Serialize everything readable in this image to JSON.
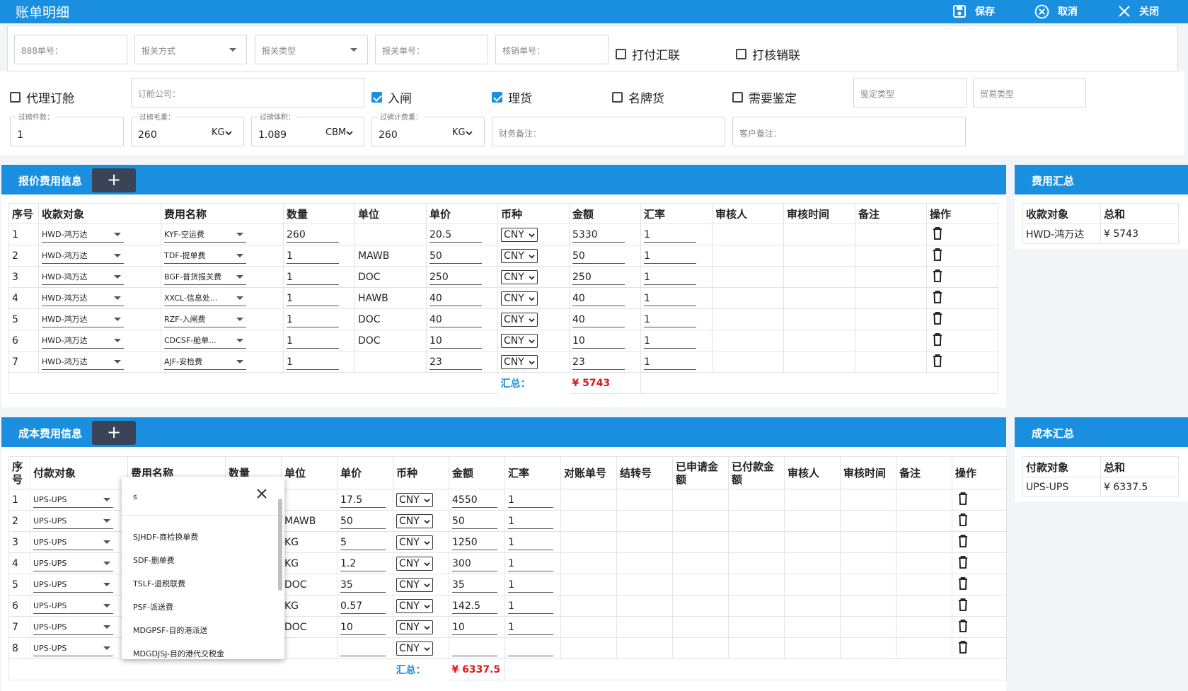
{
  "header": {
    "title": "账单明细",
    "save": "保存",
    "cancel": "取消",
    "close": "关闭"
  },
  "filters": {
    "no888": "888单号：",
    "declare_method": "报关方式",
    "declare_type": "报关类型",
    "declare_no": "报关单号：",
    "verify_no": "核销单号：",
    "print_pay": "打付汇联",
    "print_verify": "打核销联",
    "agent_booking": "代理订舱",
    "booking_company": "订舱公司：",
    "gate_in": "入闸",
    "cargo_sort": "理货",
    "brand_goods": "名牌货",
    "need_appraisal": "需要鉴定",
    "appraisal_type": "鉴定类型",
    "trade_type": "贸易类型",
    "pieces_label": "过磅件数：",
    "pieces": "1",
    "gross_label": "过磅毛重：",
    "gross": "260",
    "gross_unit": "KG",
    "volume_label": "过磅体积：",
    "volume": "1.089",
    "volume_unit": "CBM",
    "charge_weight_label": "过磅计费重：",
    "charge_weight": "260",
    "charge_weight_unit": "KG",
    "finance_note": "财务备注：",
    "customer_note": "客户备注："
  },
  "quote": {
    "title": "报价费用信息",
    "add": "+",
    "headers": [
      "序号",
      "收款对象",
      "费用名称",
      "数量",
      "单位",
      "单价",
      "币种",
      "金额",
      "汇率",
      "审核人",
      "审核时间",
      "备注",
      "操作"
    ],
    "rows": [
      {
        "no": "1",
        "payee": "HWD-鸿万达",
        "fee": "KYF-空运费",
        "qty": "260",
        "unit": "",
        "price": "20.5",
        "cur": "CNY",
        "amount": "5330",
        "rate": "1"
      },
      {
        "no": "2",
        "payee": "HWD-鸿万达",
        "fee": "TDF-提单费",
        "qty": "1",
        "unit": "MAWB",
        "price": "50",
        "cur": "CNY",
        "amount": "50",
        "rate": "1"
      },
      {
        "no": "3",
        "payee": "HWD-鸿万达",
        "fee": "BGF-普货报关费",
        "qty": "1",
        "unit": "DOC",
        "price": "250",
        "cur": "CNY",
        "amount": "250",
        "rate": "1"
      },
      {
        "no": "4",
        "payee": "HWD-鸿万达",
        "fee": "XXCL-信息处...",
        "qty": "1",
        "unit": "HAWB",
        "price": "40",
        "cur": "CNY",
        "amount": "40",
        "rate": "1"
      },
      {
        "no": "5",
        "payee": "HWD-鸿万达",
        "fee": "RZF-入闸费",
        "qty": "1",
        "unit": "DOC",
        "price": "40",
        "cur": "CNY",
        "amount": "40",
        "rate": "1"
      },
      {
        "no": "6",
        "payee": "HWD-鸿万达",
        "fee": "CDCSF-舱单...",
        "qty": "1",
        "unit": "DOC",
        "price": "10",
        "cur": "CNY",
        "amount": "10",
        "rate": "1"
      },
      {
        "no": "7",
        "payee": "HWD-鸿万达",
        "fee": "AJF-安检费",
        "qty": "1",
        "unit": "",
        "price": "23",
        "cur": "CNY",
        "amount": "23",
        "rate": "1"
      }
    ],
    "total_label": "汇总：",
    "total": "¥ 5743"
  },
  "quote_summary": {
    "title": "费用汇总",
    "col1": "收款对象",
    "col2": "总和",
    "payee": "HWD-鸿万达",
    "sum": "¥ 5743"
  },
  "cost": {
    "title": "成本费用信息",
    "add": "+",
    "headers": [
      "序号",
      "付款对象",
      "费用名称",
      "数量",
      "单位",
      "单价",
      "币种",
      "金额",
      "汇率",
      "对账单号",
      "结转号",
      "已申请金额",
      "已付款金额",
      "审核人",
      "审核时间",
      "备注",
      "操作"
    ],
    "rows": [
      {
        "no": "1",
        "payer": "UPS-UPS",
        "unit": "",
        "price": "17.5",
        "cur": "CNY",
        "amount": "4550",
        "rate": "1"
      },
      {
        "no": "2",
        "payer": "UPS-UPS",
        "unit": "MAWB",
        "price": "50",
        "cur": "CNY",
        "amount": "50",
        "rate": "1"
      },
      {
        "no": "3",
        "payer": "UPS-UPS",
        "unit": "KG",
        "price": "5",
        "cur": "CNY",
        "amount": "1250",
        "rate": "1"
      },
      {
        "no": "4",
        "payer": "UPS-UPS",
        "unit": "KG",
        "price": "1.2",
        "cur": "CNY",
        "amount": "300",
        "rate": "1"
      },
      {
        "no": "5",
        "payer": "UPS-UPS",
        "unit": "DOC",
        "price": "35",
        "cur": "CNY",
        "amount": "35",
        "rate": "1"
      },
      {
        "no": "6",
        "payer": "UPS-UPS",
        "unit": "KG",
        "price": "0.57",
        "cur": "CNY",
        "amount": "142.5",
        "rate": "1"
      },
      {
        "no": "7",
        "payer": "UPS-UPS",
        "unit": "DOC",
        "price": "10",
        "cur": "CNY",
        "amount": "10",
        "rate": "1"
      },
      {
        "no": "8",
        "payer": "UPS-UPS",
        "unit": "",
        "price": "",
        "cur": "CNY",
        "amount": "",
        "rate": ""
      }
    ],
    "total_label": "汇总：",
    "total": "¥ 6337.5"
  },
  "cost_summary": {
    "title": "成本汇总",
    "col1": "付款对象",
    "col2": "总和",
    "payer": "UPS-UPS",
    "sum": "¥ 6337.5"
  },
  "popup": {
    "search": "s",
    "options": [
      "SJHDF-商检换单费",
      "SDF-删单费",
      "TSLF-退税联费",
      "PSF-派送费",
      "MDGPSF-目的港派送",
      "MDGDJSJ-目的港代交税金"
    ]
  },
  "colors": {
    "accent": "#1a8fe0",
    "dark_button": "#3a4456",
    "total_red": "#e01919"
  }
}
